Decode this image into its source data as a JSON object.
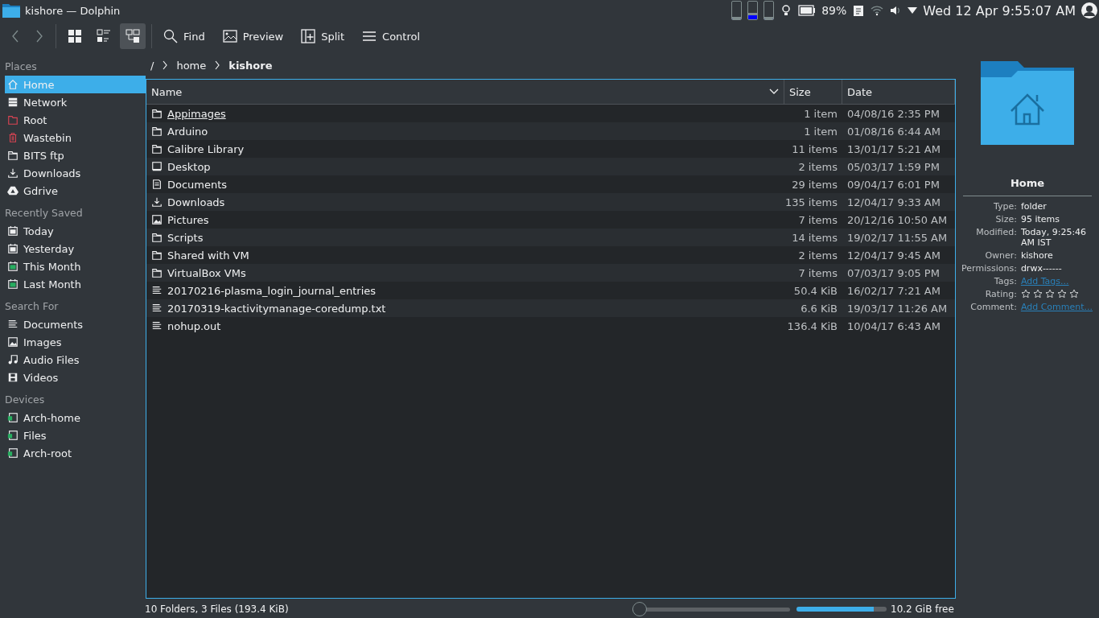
{
  "window": {
    "title": "kishore — Dolphin"
  },
  "tray": {
    "meters": [
      {
        "level": 0.1
      },
      {
        "level": 0.35
      },
      {
        "level": 0
      }
    ],
    "battery": "89%",
    "clock": "Wed 12 Apr 9:55:07 AM"
  },
  "toolbar": {
    "view_modes": [
      {
        "kind": "icons",
        "selected": false
      },
      {
        "kind": "compact",
        "selected": false
      },
      {
        "kind": "details",
        "selected": true
      }
    ],
    "buttons": [
      {
        "kind": "find",
        "label": "Find"
      },
      {
        "kind": "preview",
        "label": "Preview"
      },
      {
        "kind": "split",
        "label": "Split"
      },
      {
        "kind": "control",
        "label": "Control"
      }
    ]
  },
  "sidebar": {
    "sections": [
      {
        "title": "Places",
        "items": [
          {
            "kind": "home",
            "label": "Home",
            "selected": true
          },
          {
            "kind": "network",
            "label": "Network",
            "selected": false
          },
          {
            "kind": "root",
            "label": "Root",
            "selected": false
          },
          {
            "kind": "trash",
            "label": "Wastebin",
            "selected": false
          },
          {
            "kind": "folder",
            "label": "BITS ftp",
            "selected": false
          },
          {
            "kind": "download",
            "label": "Downloads",
            "selected": false
          },
          {
            "kind": "gdrive",
            "label": "Gdrive",
            "selected": false
          }
        ]
      },
      {
        "title": "Recently Saved",
        "items": [
          {
            "kind": "calendar",
            "label": "Today",
            "selected": false
          },
          {
            "kind": "calendar",
            "label": "Yesterday",
            "selected": false
          },
          {
            "kind": "calendar-month",
            "label": "This Month",
            "selected": false
          },
          {
            "kind": "calendar-month",
            "label": "Last Month",
            "selected": false
          }
        ]
      },
      {
        "title": "Search For",
        "items": [
          {
            "kind": "text",
            "label": "Documents",
            "selected": false
          },
          {
            "kind": "image",
            "label": "Images",
            "selected": false
          },
          {
            "kind": "audio",
            "label": "Audio Files",
            "selected": false
          },
          {
            "kind": "video",
            "label": "Videos",
            "selected": false
          }
        ]
      },
      {
        "title": "Devices",
        "items": [
          {
            "kind": "drive",
            "label": "Arch-home",
            "selected": false
          },
          {
            "kind": "drive",
            "label": "Files",
            "selected": false
          },
          {
            "kind": "drive",
            "label": "Arch-root",
            "selected": false
          }
        ]
      }
    ]
  },
  "breadcrumb": [
    "/",
    "home",
    "kishore"
  ],
  "table": {
    "columns": [
      "Name",
      "Size",
      "Date"
    ],
    "rows": [
      {
        "kind": "folder",
        "name": "Appimages",
        "size": "1 item",
        "date": "04/08/16 2:35 PM",
        "hovered": true
      },
      {
        "kind": "folder",
        "name": "Arduino",
        "size": "1 item",
        "date": "01/08/16 6:44 AM",
        "hovered": false
      },
      {
        "kind": "folder",
        "name": "Calibre Library",
        "size": "11 items",
        "date": "13/01/17 5:21 AM",
        "hovered": false
      },
      {
        "kind": "desktop",
        "name": "Desktop",
        "size": "2 items",
        "date": "05/03/17 1:59 PM",
        "hovered": false
      },
      {
        "kind": "documents",
        "name": "Documents",
        "size": "29 items",
        "date": "09/04/17 6:01 PM",
        "hovered": false
      },
      {
        "kind": "download",
        "name": "Downloads",
        "size": "135 items",
        "date": "12/04/17 9:33 AM",
        "hovered": false
      },
      {
        "kind": "image",
        "name": "Pictures",
        "size": "7 items",
        "date": "20/12/16 10:50 AM",
        "hovered": false
      },
      {
        "kind": "folder",
        "name": "Scripts",
        "size": "14 items",
        "date": "19/02/17 11:55 AM",
        "hovered": false
      },
      {
        "kind": "folder",
        "name": "Shared with VM",
        "size": "2 items",
        "date": "12/04/17 9:45 AM",
        "hovered": false
      },
      {
        "kind": "folder",
        "name": "VirtualBox VMs",
        "size": "7 items",
        "date": "07/03/17 9:05 PM",
        "hovered": false
      },
      {
        "kind": "text",
        "name": "20170216-plasma_login_journal_entries",
        "size": "50.4 KiB",
        "date": "16/02/17 7:21 AM",
        "hovered": false
      },
      {
        "kind": "text",
        "name": "20170319-kactivitymanage-coredump.txt",
        "size": "6.6 KiB",
        "date": "19/03/17 11:26 AM",
        "hovered": false
      },
      {
        "kind": "text",
        "name": "nohup.out",
        "size": "136.4 KiB",
        "date": "10/04/17 6:43 AM",
        "hovered": false
      }
    ]
  },
  "info_panel": {
    "title": "Home",
    "fields": [
      {
        "kind": "text",
        "label": "Type:",
        "value": "folder"
      },
      {
        "kind": "text",
        "label": "Size:",
        "value": "95 items"
      },
      {
        "kind": "text",
        "label": "Modified:",
        "value": "Today, 9:25:46 AM IST"
      },
      {
        "kind": "text",
        "label": "Owner:",
        "value": "kishore"
      },
      {
        "kind": "text",
        "label": "Permissions:",
        "value": "drwx------"
      },
      {
        "kind": "link",
        "label": "Tags:",
        "value": "Add Tags..."
      },
      {
        "kind": "rating",
        "label": "Rating:",
        "stars": 0
      },
      {
        "kind": "link",
        "label": "Comment:",
        "value": "Add Comment..."
      }
    ]
  },
  "status_bar": {
    "summary": "10 Folders, 3 Files (193.4 KiB)",
    "zoom": {
      "level": 0
    },
    "space": {
      "level": 0.86
    },
    "free": "10.2 GiB free"
  }
}
